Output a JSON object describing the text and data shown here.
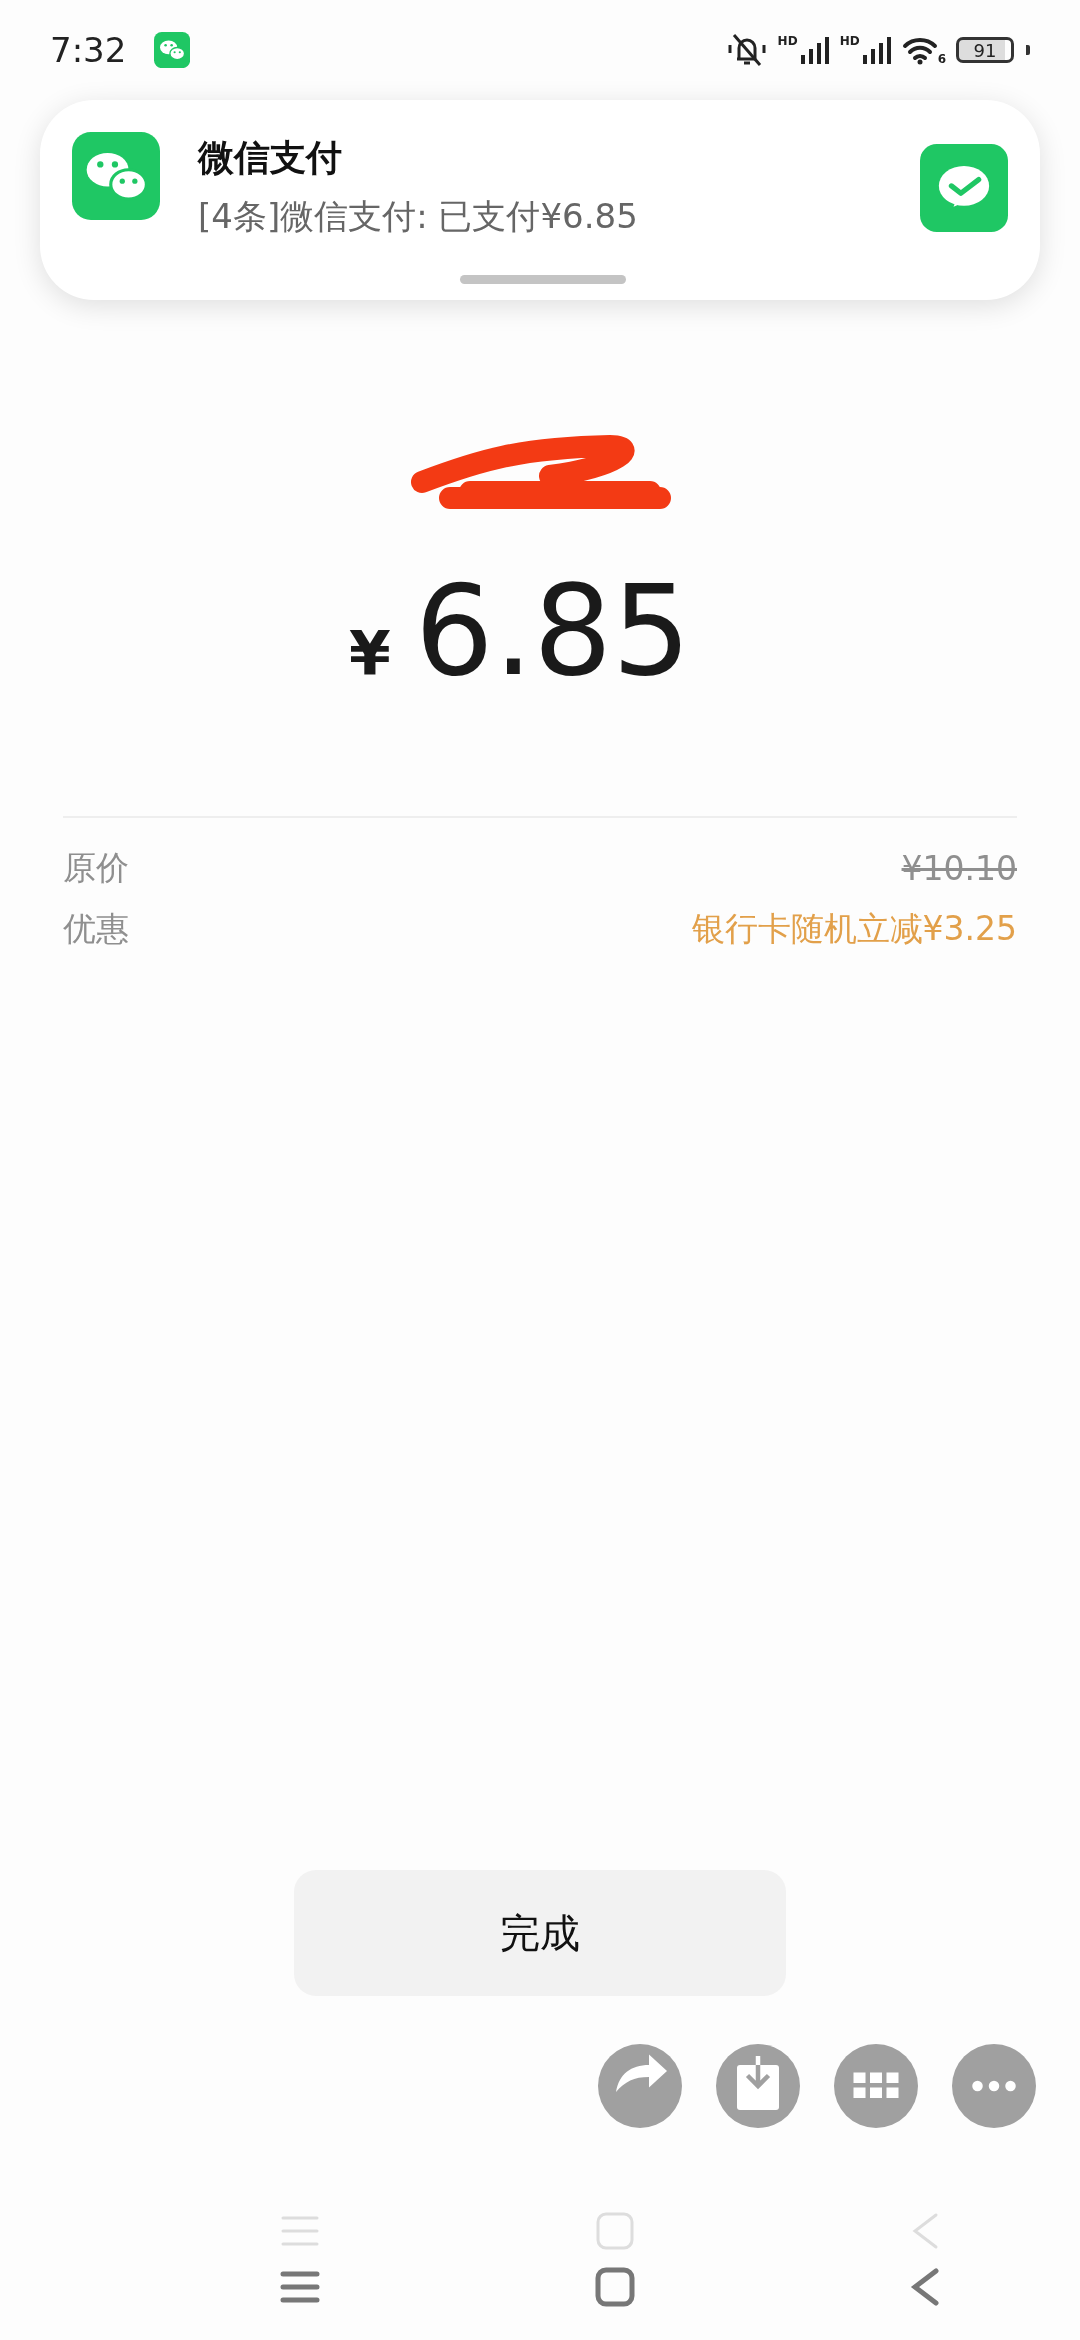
{
  "status_bar": {
    "time": "7:32",
    "signals": [
      {
        "label": "HD"
      },
      {
        "label": "HD"
      }
    ],
    "wifi_label": "6",
    "battery": "91"
  },
  "notification": {
    "title": "微信支付",
    "message": "[4条]微信支付: 已支付¥6.85"
  },
  "payment": {
    "currency": "¥",
    "amount": "6.85"
  },
  "details": [
    {
      "label": "原价",
      "value": "¥10.10",
      "kind": "struck"
    },
    {
      "label": "优惠",
      "value": "银行卡随机立减¥3.25",
      "kind": "discount"
    }
  ],
  "done_button": "完成",
  "actions": [
    {
      "kind": "share"
    },
    {
      "kind": "save"
    },
    {
      "kind": "apps"
    },
    {
      "kind": "more"
    }
  ]
}
